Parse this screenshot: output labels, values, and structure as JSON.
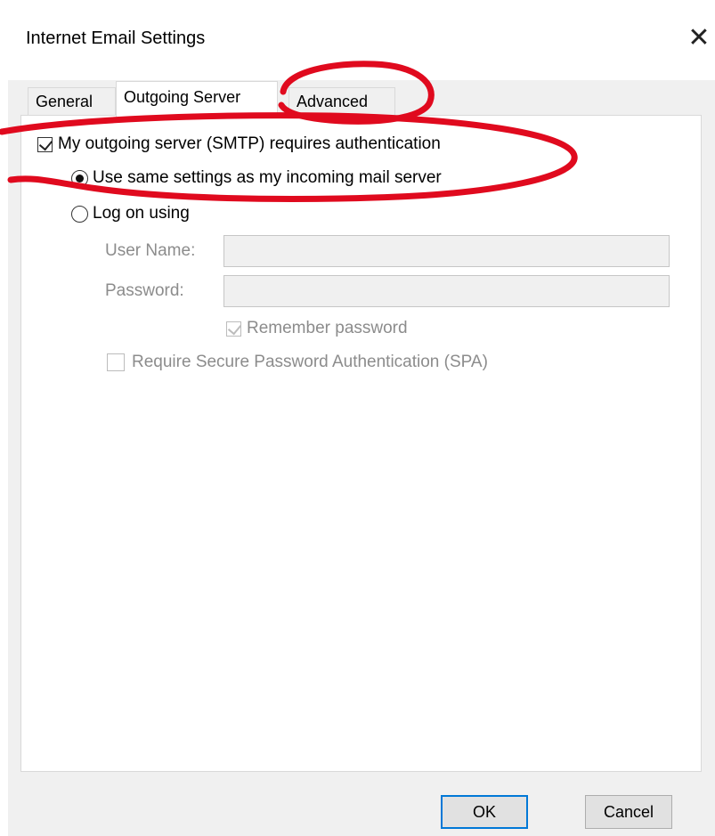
{
  "dialog": {
    "title": "Internet Email Settings",
    "close_glyph": "✕"
  },
  "tabs": [
    {
      "label": "General"
    },
    {
      "label": "Outgoing Server"
    },
    {
      "label": "Advanced"
    }
  ],
  "auth": {
    "requires_auth_label": "My outgoing server (SMTP) requires authentication",
    "requires_auth_checked": true,
    "use_same_label": "Use same settings as my incoming mail server",
    "use_same_selected": true,
    "log_on_label": "Log on using",
    "log_on_selected": false
  },
  "credentials": {
    "username_label": "User Name:",
    "username_value": "",
    "password_label": "Password:",
    "password_value": "",
    "remember_label": "Remember password",
    "remember_checked": true,
    "spa_label": "Require Secure Password Authentication (SPA)",
    "spa_checked": false
  },
  "buttons": {
    "ok": "OK",
    "cancel": "Cancel"
  },
  "colors": {
    "annotation": "#e00a1e",
    "default_button_border": "#0078d7"
  }
}
